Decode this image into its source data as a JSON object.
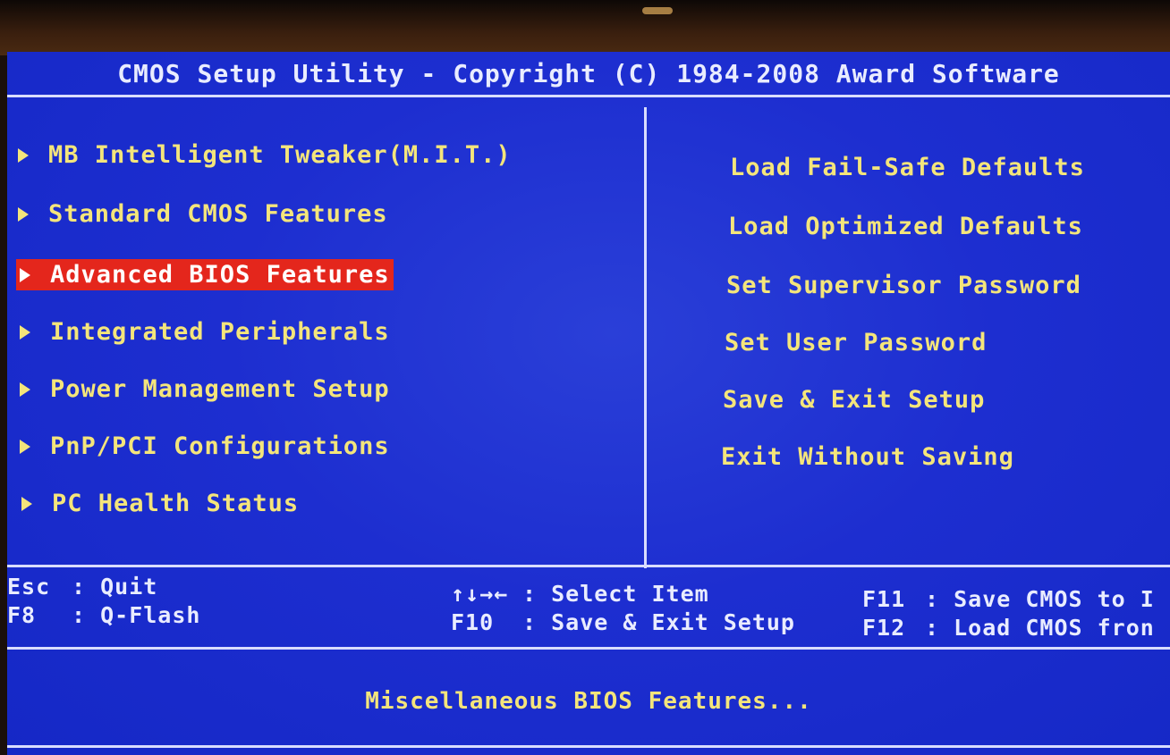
{
  "title": "CMOS Setup Utility - Copyright (C) 1984-2008 Award Software",
  "left_menu": [
    {
      "label": "MB Intelligent Tweaker(M.I.T.)"
    },
    {
      "label": "Standard CMOS Features"
    },
    {
      "label": "Advanced BIOS Features"
    },
    {
      "label": "Integrated Peripherals"
    },
    {
      "label": "Power Management Setup"
    },
    {
      "label": "PnP/PCI Configurations"
    },
    {
      "label": "PC Health Status"
    }
  ],
  "selected_index": 2,
  "right_menu": [
    {
      "label": "Load Fail-Safe Defaults"
    },
    {
      "label": "Load Optimized Defaults"
    },
    {
      "label": "Set Supervisor Password"
    },
    {
      "label": "Set User Password"
    },
    {
      "label": "Save & Exit Setup"
    },
    {
      "label": "Exit Without Saving"
    }
  ],
  "help": {
    "esc_key": "Esc",
    "esc_action": ": Quit",
    "f8_key": "F8",
    "f8_action": ": Q-Flash",
    "arrows_key": "↑↓→←",
    "arrows_action": ": Select Item",
    "f10_key": "F10",
    "f10_action": ": Save & Exit Setup",
    "f11_key": "F11",
    "f11_action": ": Save CMOS to I",
    "f12_key": "F12",
    "f12_action": ": Load CMOS fron"
  },
  "status": "Miscellaneous BIOS Features...",
  "colors": {
    "background": "#1d2ed0",
    "menu_text": "#f4e57b",
    "selection": "#e4261c",
    "lines": "#d9ddff"
  }
}
